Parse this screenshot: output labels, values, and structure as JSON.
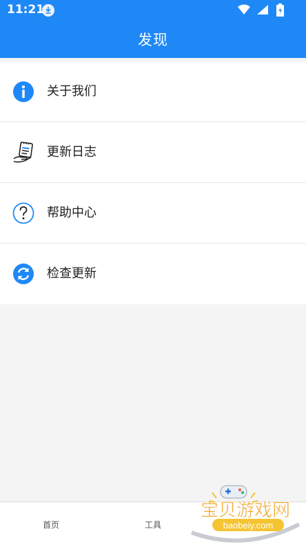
{
  "status_bar": {
    "time": "11:21",
    "icons": [
      "download-notification-icon",
      "wifi-icon",
      "signal-icon",
      "battery-icon"
    ]
  },
  "header": {
    "title": "发现"
  },
  "menu": {
    "items": [
      {
        "label": "关于我们",
        "icon": "info-icon"
      },
      {
        "label": "更新日志",
        "icon": "notepad-icon"
      },
      {
        "label": "帮助中心",
        "icon": "help-icon"
      },
      {
        "label": "检查更新",
        "icon": "refresh-icon"
      }
    ]
  },
  "bottom_nav": {
    "tabs": [
      {
        "label": "首页"
      },
      {
        "label": "工具"
      }
    ]
  },
  "watermark": {
    "text": "宝贝游戏网",
    "domain": "baobeiy.com"
  },
  "colors": {
    "primary": "#1f88f7",
    "background": "#f4f4f4",
    "surface": "#ffffff"
  }
}
